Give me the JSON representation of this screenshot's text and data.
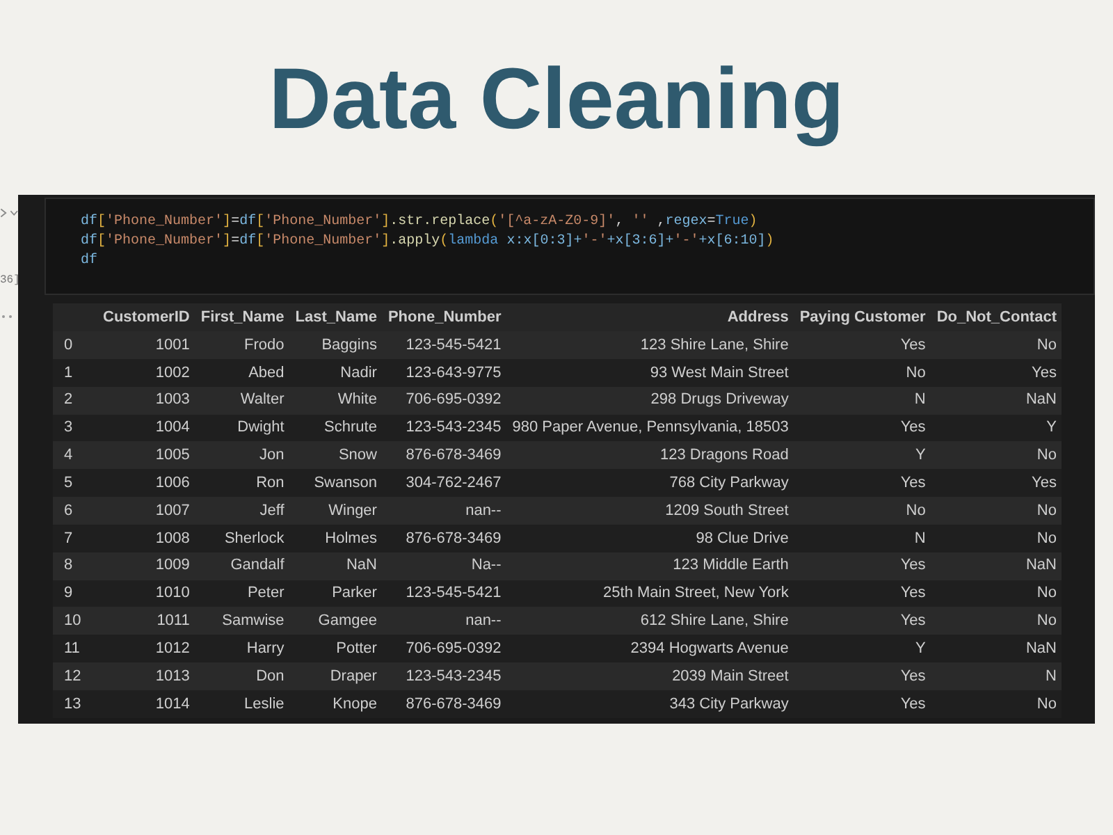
{
  "title": "Data Cleaning",
  "notebook": {
    "prompt": "36]",
    "code_lines": [
      [
        {
          "text": "df",
          "kind": "var"
        },
        {
          "text": "[",
          "kind": "bracket"
        },
        {
          "text": "'Phone_Number'",
          "kind": "str"
        },
        {
          "text": "]",
          "kind": "bracket"
        },
        {
          "text": "=",
          "kind": "op"
        },
        {
          "text": "df",
          "kind": "var"
        },
        {
          "text": "[",
          "kind": "bracket"
        },
        {
          "text": "'Phone_Number'",
          "kind": "str"
        },
        {
          "text": "]",
          "kind": "bracket"
        },
        {
          "text": ".str.replace",
          "kind": "fn"
        },
        {
          "text": "(",
          "kind": "bracket"
        },
        {
          "text": "'[^a-zA-Z0-9]'",
          "kind": "str"
        },
        {
          "text": ", ",
          "kind": "op"
        },
        {
          "text": "''",
          "kind": "str"
        },
        {
          "text": " ,",
          "kind": "op"
        },
        {
          "text": "regex",
          "kind": "var"
        },
        {
          "text": "=",
          "kind": "op"
        },
        {
          "text": "True",
          "kind": "kw"
        },
        {
          "text": ")",
          "kind": "bracket"
        }
      ],
      [
        {
          "text": "df",
          "kind": "var"
        },
        {
          "text": "[",
          "kind": "bracket"
        },
        {
          "text": "'Phone_Number'",
          "kind": "str"
        },
        {
          "text": "]",
          "kind": "bracket"
        },
        {
          "text": "=",
          "kind": "op"
        },
        {
          "text": "df",
          "kind": "var"
        },
        {
          "text": "[",
          "kind": "bracket"
        },
        {
          "text": "'Phone_Number'",
          "kind": "str"
        },
        {
          "text": "]",
          "kind": "bracket"
        },
        {
          "text": ".apply",
          "kind": "fn"
        },
        {
          "text": "(",
          "kind": "bracket"
        },
        {
          "text": "lambda",
          "kind": "kw"
        },
        {
          "text": " x:x[0:3]+",
          "kind": "var"
        },
        {
          "text": "'-'",
          "kind": "str"
        },
        {
          "text": "+x[3:6]+",
          "kind": "var"
        },
        {
          "text": "'-'",
          "kind": "str"
        },
        {
          "text": "+x[6:10]",
          "kind": "var"
        },
        {
          "text": ")",
          "kind": "bracket"
        }
      ],
      [
        {
          "text": "df",
          "kind": "var"
        }
      ]
    ],
    "table": {
      "columns": [
        "CustomerID",
        "First_Name",
        "Last_Name",
        "Phone_Number",
        "Address",
        "Paying Customer",
        "Do_Not_Contact"
      ],
      "rows": [
        {
          "index": "0",
          "cells": [
            "1001",
            "Frodo",
            "Baggins",
            "123-545-5421",
            "123 Shire Lane, Shire",
            "Yes",
            "No"
          ]
        },
        {
          "index": "1",
          "cells": [
            "1002",
            "Abed",
            "Nadir",
            "123-643-9775",
            "93 West Main Street",
            "No",
            "Yes"
          ]
        },
        {
          "index": "2",
          "cells": [
            "1003",
            "Walter",
            "White",
            "706-695-0392",
            "298 Drugs Driveway",
            "N",
            "NaN"
          ]
        },
        {
          "index": "3",
          "cells": [
            "1004",
            "Dwight",
            "Schrute",
            "123-543-2345",
            "980 Paper Avenue, Pennsylvania, 18503",
            "Yes",
            "Y"
          ]
        },
        {
          "index": "4",
          "cells": [
            "1005",
            "Jon",
            "Snow",
            "876-678-3469",
            "123 Dragons Road",
            "Y",
            "No"
          ]
        },
        {
          "index": "5",
          "cells": [
            "1006",
            "Ron",
            "Swanson",
            "304-762-2467",
            "768 City Parkway",
            "Yes",
            "Yes"
          ]
        },
        {
          "index": "6",
          "cells": [
            "1007",
            "Jeff",
            "Winger",
            "nan--",
            "1209 South Street",
            "No",
            "No"
          ]
        },
        {
          "index": "7",
          "cells": [
            "1008",
            "Sherlock",
            "Holmes",
            "876-678-3469",
            "98 Clue Drive",
            "N",
            "No"
          ]
        },
        {
          "index": "8",
          "cells": [
            "1009",
            "Gandalf",
            "NaN",
            "Na--",
            "123 Middle Earth",
            "Yes",
            "NaN"
          ]
        },
        {
          "index": "9",
          "cells": [
            "1010",
            "Peter",
            "Parker",
            "123-545-5421",
            "25th Main Street, New York",
            "Yes",
            "No"
          ]
        },
        {
          "index": "10",
          "cells": [
            "1011",
            "Samwise",
            "Gamgee",
            "nan--",
            "612 Shire Lane, Shire",
            "Yes",
            "No"
          ]
        },
        {
          "index": "11",
          "cells": [
            "1012",
            "Harry",
            "Potter",
            "706-695-0392",
            "2394 Hogwarts Avenue",
            "Y",
            "NaN"
          ]
        },
        {
          "index": "12",
          "cells": [
            "1013",
            "Don",
            "Draper",
            "123-543-2345",
            "2039 Main Street",
            "Yes",
            "N"
          ]
        },
        {
          "index": "13",
          "cells": [
            "1014",
            "Leslie",
            "Knope",
            "876-678-3469",
            "343 City Parkway",
            "Yes",
            "No"
          ]
        }
      ]
    }
  }
}
